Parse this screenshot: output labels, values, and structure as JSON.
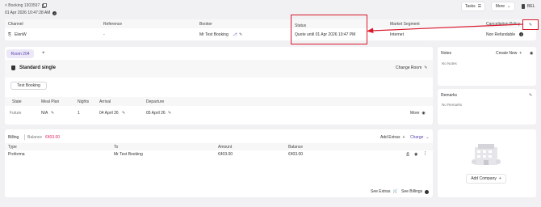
{
  "header": {
    "breadcrumb": "< Booking 1303597",
    "datetime": "01 Apr 2026 10:47:28 AM",
    "tasks_label": "Tasks",
    "more_label": "More",
    "lang": "BEL"
  },
  "booking_table": {
    "columns": [
      "Channel",
      "Reference",
      "Booker",
      "Status",
      "Market Segment",
      "Cancellation Policy"
    ],
    "row": {
      "channel": "ElenW",
      "reference": "-",
      "booker": "Mr Test Booking",
      "status": "Quote until 01 Apr 2026 10:47 PM",
      "market_segment": "Internet",
      "cancellation_policy": "Non Refundable"
    }
  },
  "rooms": {
    "tab_label": "Room 204",
    "add_tab": "+",
    "room_type": "Standard single",
    "change_room_label": "Change Room",
    "guest_chip": "Test Booking",
    "columns": [
      "State",
      "Meal Plan",
      "Nights",
      "Arrival",
      "Departure"
    ],
    "row": {
      "state": "Future",
      "meal_plan": "N/A",
      "nights": "1",
      "arrival": "04 April 26",
      "departure": "05 April 26",
      "more_label": "More"
    }
  },
  "billing": {
    "billing_label": "Billing",
    "balance_label": "Balance",
    "balance_value": "€403.00",
    "add_extras_label": "Add Extras",
    "charge_label": "Charge",
    "columns": [
      "Type",
      "To",
      "Amount",
      "Balance"
    ],
    "row": {
      "type": "Proforma",
      "to": "Mr Test Booking",
      "amount": "€403.00",
      "balance": "€403.00"
    },
    "see_extras_label": "See Extras",
    "see_billings_label": "See Billings"
  },
  "notes": {
    "title": "Notes",
    "create_label": "Create New",
    "empty": "No Notes"
  },
  "remarks": {
    "title": "Remarks",
    "empty": "No Remarks"
  },
  "company": {
    "add_label": "Add Company"
  },
  "colors": {
    "accent": "#e0245e",
    "highlight_red": "#d9182c",
    "tab_bg": "#ece8f8"
  }
}
